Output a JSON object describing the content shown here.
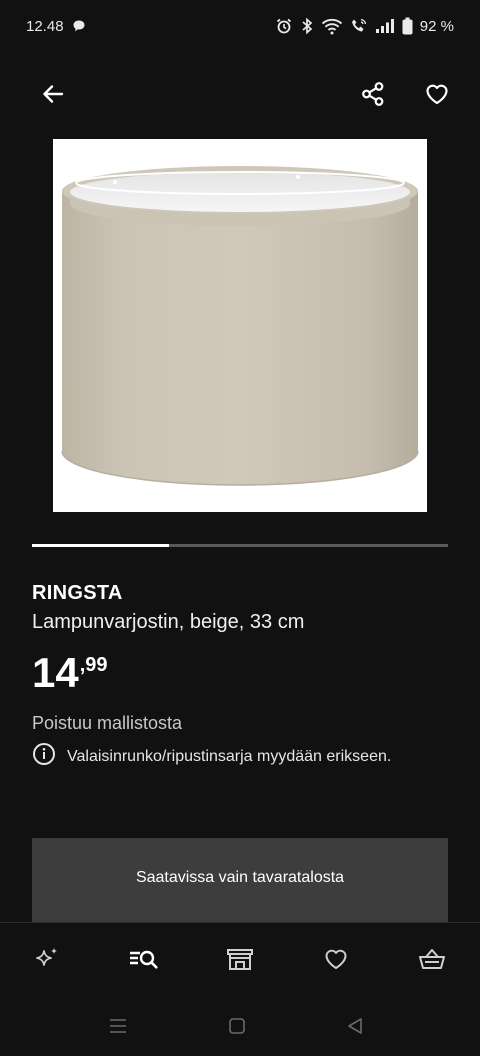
{
  "status_bar": {
    "time": "12.48",
    "battery": "92 %"
  },
  "product": {
    "brand": "RINGSTA",
    "description": "Lampunvarjostin, beige, 33 cm",
    "price_integer": "14",
    "price_decimal": ",99",
    "status": "Poistuu mallistosta",
    "info_note": "Valaisinrunko/ripustinsarja myydään erikseen.",
    "image_index": 1,
    "image_count": 3,
    "carousel_progress": 0.33
  },
  "store_banner": {
    "label": "Saatavissa vain tavaratalosta"
  },
  "bottom_nav": {
    "items": [
      {
        "icon": "sparkle-icon",
        "active": false
      },
      {
        "icon": "search-list-icon",
        "active": true
      },
      {
        "icon": "store-icon",
        "active": false
      },
      {
        "icon": "heart-icon",
        "active": false
      },
      {
        "icon": "basket-icon",
        "active": false
      }
    ]
  },
  "colors": {
    "background": "#111111",
    "banner": "#3d3d3d",
    "shade": "#c9c1b3"
  }
}
